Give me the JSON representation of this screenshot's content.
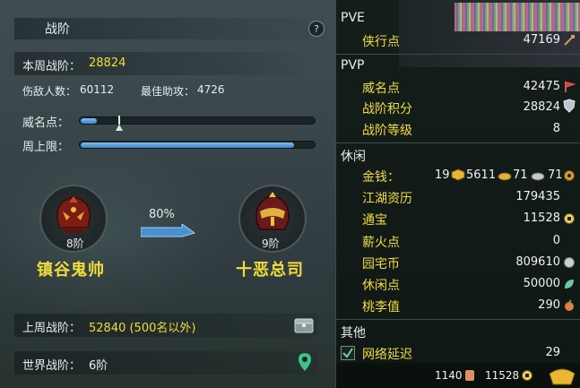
{
  "left": {
    "title": "战阶",
    "help": "?",
    "weekly_rank_label": "本周战阶：",
    "weekly_rank_value": "28824",
    "defeated_label": "伤敌人数：",
    "defeated_value": "60112",
    "assist_label": "最佳助攻：",
    "assist_value": "4726",
    "prestige_label": "威名点：",
    "prestige_fill": 0.07,
    "prestige_marker": 0.16,
    "weekly_cap_label": "周上限：",
    "weekly_cap_fill": 0.91,
    "current_rank_level": "8阶",
    "current_rank_name": "镇谷鬼帅",
    "progress_percent": "80%",
    "next_rank_level": "9阶",
    "next_rank_name": "十恶总司",
    "last_week_label": "上周战阶：",
    "last_week_value": "52840 (500名以外)",
    "world_rank_label": "世界战阶：",
    "world_rank_value": "6阶"
  },
  "right": {
    "pve_title": "PVE",
    "pve_items": [
      {
        "label": "侠行点",
        "value": "47169",
        "icon": "sword-icon"
      }
    ],
    "pvp_title": "PVP",
    "pvp_items": [
      {
        "label": "威名点",
        "value": "42475",
        "icon": "flag-icon"
      },
      {
        "label": "战阶积分",
        "value": "28824",
        "icon": "shield-icon"
      },
      {
        "label": "战阶等级",
        "value": "8",
        "icon": ""
      }
    ],
    "leisure_title": "休闲",
    "gold_label": "金钱：",
    "gold_gold": "19",
    "gold_silver": "5611",
    "gold_copper": "71",
    "gold_extra": "71",
    "leisure_items": [
      {
        "label": "江湖资历",
        "value": "179435"
      },
      {
        "label": "通宝",
        "value": "11528"
      },
      {
        "label": "薪火点",
        "value": "0"
      },
      {
        "label": "园宅币",
        "value": "809610"
      },
      {
        "label": "休闲点",
        "value": "50000"
      },
      {
        "label": "桃李值",
        "value": "290"
      }
    ],
    "other_title": "其他",
    "latency_label": "网络延迟",
    "latency_value": "29",
    "footer_a": "1140",
    "footer_b": "11528"
  },
  "colors": {
    "accent_yellow": "#f0dd3a",
    "bar_blue": "#4a90d0"
  }
}
